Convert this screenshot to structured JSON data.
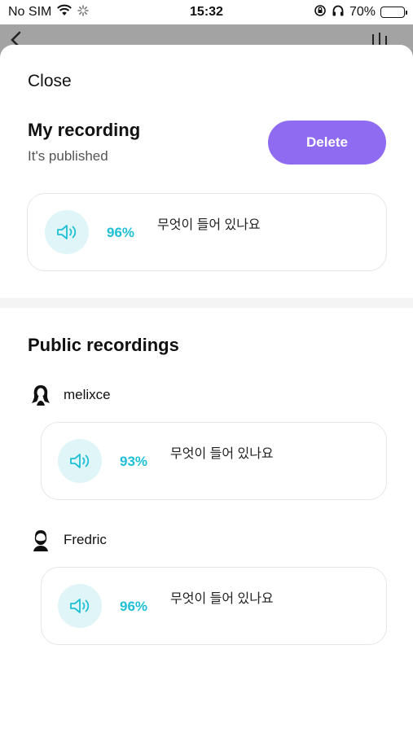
{
  "status_bar": {
    "carrier": "No SIM",
    "time": "15:32",
    "battery": "70%",
    "battery_level": 0.7
  },
  "sheet": {
    "close_label": "Close",
    "my_recording": {
      "title": "My recording",
      "subtitle": "It's published",
      "delete_label": "Delete",
      "score": "96%",
      "phrase": "무엇이 들어 있나요"
    },
    "public": {
      "title": "Public recordings",
      "items": [
        {
          "user": "melixce",
          "score": "93%",
          "phrase": "무엇이 들어 있나요"
        },
        {
          "user": "Fredric",
          "score": "96%",
          "phrase": "무엇이 들어 있나요"
        }
      ]
    }
  },
  "colors": {
    "accent_purple": "#8f6bf2",
    "score_cyan": "#1fc0d6",
    "speaker_bg": "#dff5f8"
  },
  "icons": [
    "wifi-icon",
    "loading-icon",
    "rotation-lock-icon",
    "headphones-icon",
    "battery-icon",
    "back-arrow-icon",
    "speaker-icon",
    "user-avatar-icon"
  ]
}
